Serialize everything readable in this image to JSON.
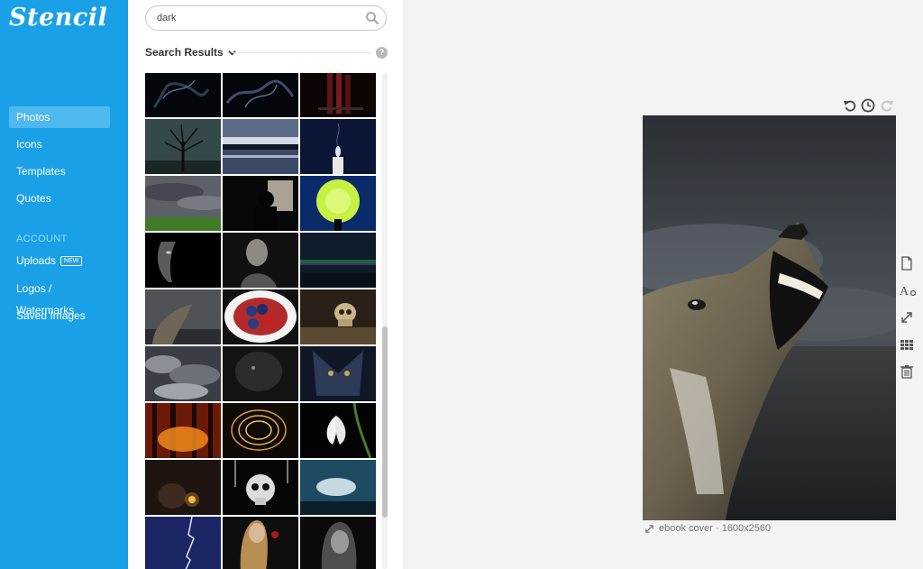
{
  "app": {
    "logo": "Stencil"
  },
  "sidebar": {
    "items": [
      {
        "label": "Photos",
        "active": true
      },
      {
        "label": "Icons"
      },
      {
        "label": "Templates"
      },
      {
        "label": "Quotes"
      }
    ],
    "account_heading": "ACCOUNT",
    "account_items": [
      {
        "label": "Uploads",
        "badge": "NEW"
      },
      {
        "label": "Logos / Watermarks"
      },
      {
        "label": "Saved Images"
      }
    ]
  },
  "search": {
    "value": "dark",
    "icon": "search-icon"
  },
  "results": {
    "title": "Search Results",
    "help": "?"
  },
  "thumbnails": [
    "smoke",
    "smoke",
    "wine-glasses",
    "bare-tree",
    "dusk-lake",
    "candle",
    "storm-field",
    "silhouette-window",
    "green-lamp",
    "face-in-shadow",
    "old-man-portrait",
    "aurora",
    "howling-dog",
    "strawberry-bowl",
    "skull-still-life",
    "dark-clouds",
    "dark-abstract",
    "wolf-face",
    "fire-forest",
    "light-rings",
    "snowdrop-flower",
    "sparkler-night",
    "skull-candles",
    "cloud-sky",
    "lightning",
    "woman-with-rose",
    "woman-portrait"
  ],
  "canvas": {
    "caption": "ebook cover · 1600x2560",
    "history_icons": [
      "undo-icon",
      "history-clock-icon",
      "redo-icon"
    ],
    "tool_icons": [
      "document-icon",
      "text-style-icon",
      "resize-icon",
      "grid-icon",
      "trash-icon"
    ]
  },
  "colors": {
    "sidebar": "#1aa0e6",
    "active_item": "#4fb8ee"
  }
}
